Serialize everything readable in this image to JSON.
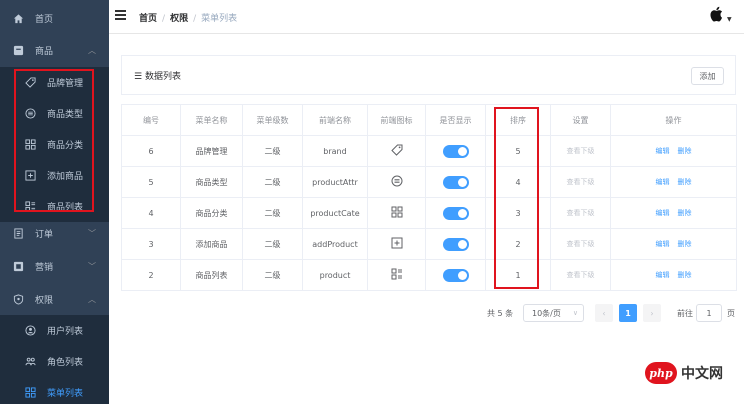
{
  "sidebar": {
    "items": [
      {
        "label": "首页",
        "icon": "home-icon",
        "arrow": ""
      },
      {
        "label": "商品",
        "icon": "product-icon",
        "arrow": "︿"
      },
      {
        "label": "品牌管理",
        "icon": "tag-icon",
        "arrow": ""
      },
      {
        "label": "商品类型",
        "icon": "type-icon",
        "arrow": ""
      },
      {
        "label": "商品分类",
        "icon": "grid-icon",
        "arrow": ""
      },
      {
        "label": "添加商品",
        "icon": "add-box-icon",
        "arrow": ""
      },
      {
        "label": "商品列表",
        "icon": "list-icon",
        "arrow": ""
      },
      {
        "label": "订单",
        "icon": "order-icon",
        "arrow": "﹀"
      },
      {
        "label": "营销",
        "icon": "marketing-icon",
        "arrow": "﹀"
      },
      {
        "label": "权限",
        "icon": "shield-icon",
        "arrow": "︿"
      },
      {
        "label": "用户列表",
        "icon": "user-icon",
        "arrow": ""
      },
      {
        "label": "角色列表",
        "icon": "role-icon",
        "arrow": ""
      },
      {
        "label": "菜单列表",
        "icon": "menu-icon",
        "arrow": ""
      }
    ],
    "bg_color": "#304156",
    "active_color": "#409eff"
  },
  "navbar": {
    "breadcrumb": [
      "首页",
      "权限",
      "菜单列表"
    ],
    "separator": "/"
  },
  "card": {
    "title": "数据列表",
    "add_label": "添加"
  },
  "table": {
    "headers": [
      "编号",
      "菜单名称",
      "菜单级数",
      "前端名称",
      "前端图标",
      "是否显示",
      "排序",
      "设置",
      "操作"
    ],
    "rows": [
      {
        "id": "6",
        "name": "品牌管理",
        "level": "二级",
        "fe_name": "brand",
        "icon": "tag-icon",
        "show": true,
        "sort": "5",
        "setting": "查看下级",
        "edit": "编辑",
        "delete": "删除"
      },
      {
        "id": "5",
        "name": "商品类型",
        "level": "二级",
        "fe_name": "productAttr",
        "icon": "type-icon",
        "show": true,
        "sort": "4",
        "setting": "查看下级",
        "edit": "编辑",
        "delete": "删除"
      },
      {
        "id": "4",
        "name": "商品分类",
        "level": "二级",
        "fe_name": "productCate",
        "icon": "grid-icon",
        "show": true,
        "sort": "3",
        "setting": "查看下级",
        "edit": "编辑",
        "delete": "删除"
      },
      {
        "id": "3",
        "name": "添加商品",
        "level": "二级",
        "fe_name": "addProduct",
        "icon": "add-box-icon",
        "show": true,
        "sort": "2",
        "setting": "查看下级",
        "edit": "编辑",
        "delete": "删除"
      },
      {
        "id": "2",
        "name": "商品列表",
        "level": "二级",
        "fe_name": "product",
        "icon": "list-icon",
        "show": true,
        "sort": "1",
        "setting": "查看下级",
        "edit": "编辑",
        "delete": "删除"
      }
    ]
  },
  "pagination": {
    "total": "共 5 条",
    "page_size": "10条/页",
    "prev": "‹",
    "current_page": "1",
    "next": "›",
    "goto_label": "前往",
    "goto_value": "1",
    "page_suffix": "页"
  },
  "watermark": {
    "logo": "php",
    "text": "中文网"
  }
}
